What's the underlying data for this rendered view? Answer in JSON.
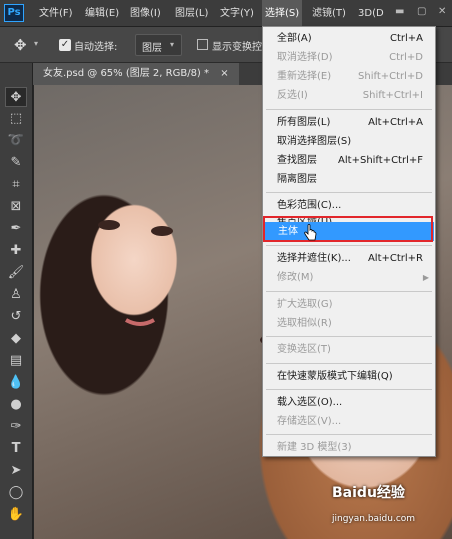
{
  "app": {
    "logo": "Ps"
  },
  "menubar": [
    {
      "label": "文件(F)"
    },
    {
      "label": "编辑(E)"
    },
    {
      "label": "图像(I)"
    },
    {
      "label": "图层(L)"
    },
    {
      "label": "文字(Y)"
    },
    {
      "label": "选择(S)",
      "active": true
    },
    {
      "label": "滤镜(T)"
    },
    {
      "label": "3D(D"
    }
  ],
  "options": {
    "auto_select_label": "自动选择:",
    "layer_select_value": "图层",
    "show_transform_label": "显示变换控"
  },
  "document_tab": {
    "title": "女友.psd @ 65% (图层 2, RGB/8) *",
    "close": "×"
  },
  "select_menu": {
    "items": [
      {
        "label": "全部(A)",
        "shortcut": "Ctrl+A",
        "disabled": false
      },
      {
        "label": "取消选择(D)",
        "shortcut": "Ctrl+D",
        "disabled": true
      },
      {
        "label": "重新选择(E)",
        "shortcut": "Shift+Ctrl+D",
        "disabled": true
      },
      {
        "label": "反选(I)",
        "shortcut": "Shift+Ctrl+I",
        "disabled": true
      },
      {
        "label": "所有图层(L)",
        "shortcut": "Alt+Ctrl+A",
        "disabled": false
      },
      {
        "label": "取消选择图层(S)",
        "shortcut": "",
        "disabled": false
      },
      {
        "label": "查找图层",
        "shortcut": "Alt+Shift+Ctrl+F",
        "disabled": false
      },
      {
        "label": "隔离图层",
        "shortcut": "",
        "disabled": false
      },
      {
        "label": "色彩范围(C)...",
        "shortcut": "",
        "disabled": false
      },
      {
        "label": "焦点区域(U)...",
        "shortcut": "",
        "disabled": false
      },
      {
        "label": "主体",
        "shortcut": "",
        "disabled": false,
        "highlighted": true
      },
      {
        "label": "选择并遮住(K)...",
        "shortcut": "Alt+Ctrl+R",
        "disabled": false
      },
      {
        "label": "修改(M)",
        "shortcut": "",
        "disabled": true,
        "submenu": true
      },
      {
        "label": "扩大选取(G)",
        "shortcut": "",
        "disabled": true
      },
      {
        "label": "选取相似(R)",
        "shortcut": "",
        "disabled": true
      },
      {
        "label": "变换选区(T)",
        "shortcut": "",
        "disabled": true
      },
      {
        "label": "在快速蒙版模式下编辑(Q)",
        "shortcut": "",
        "disabled": false
      },
      {
        "label": "载入选区(O)...",
        "shortcut": "",
        "disabled": false
      },
      {
        "label": "存储选区(V)...",
        "shortcut": "",
        "disabled": true
      },
      {
        "label": "新建 3D 模型(3)",
        "shortcut": "",
        "disabled": true
      }
    ]
  },
  "watermark": {
    "brand": "Baidu经验",
    "url": "jingyan.baidu.com"
  },
  "colors": {
    "highlight": "#3299ff",
    "annotation_box": "#e2262b"
  }
}
